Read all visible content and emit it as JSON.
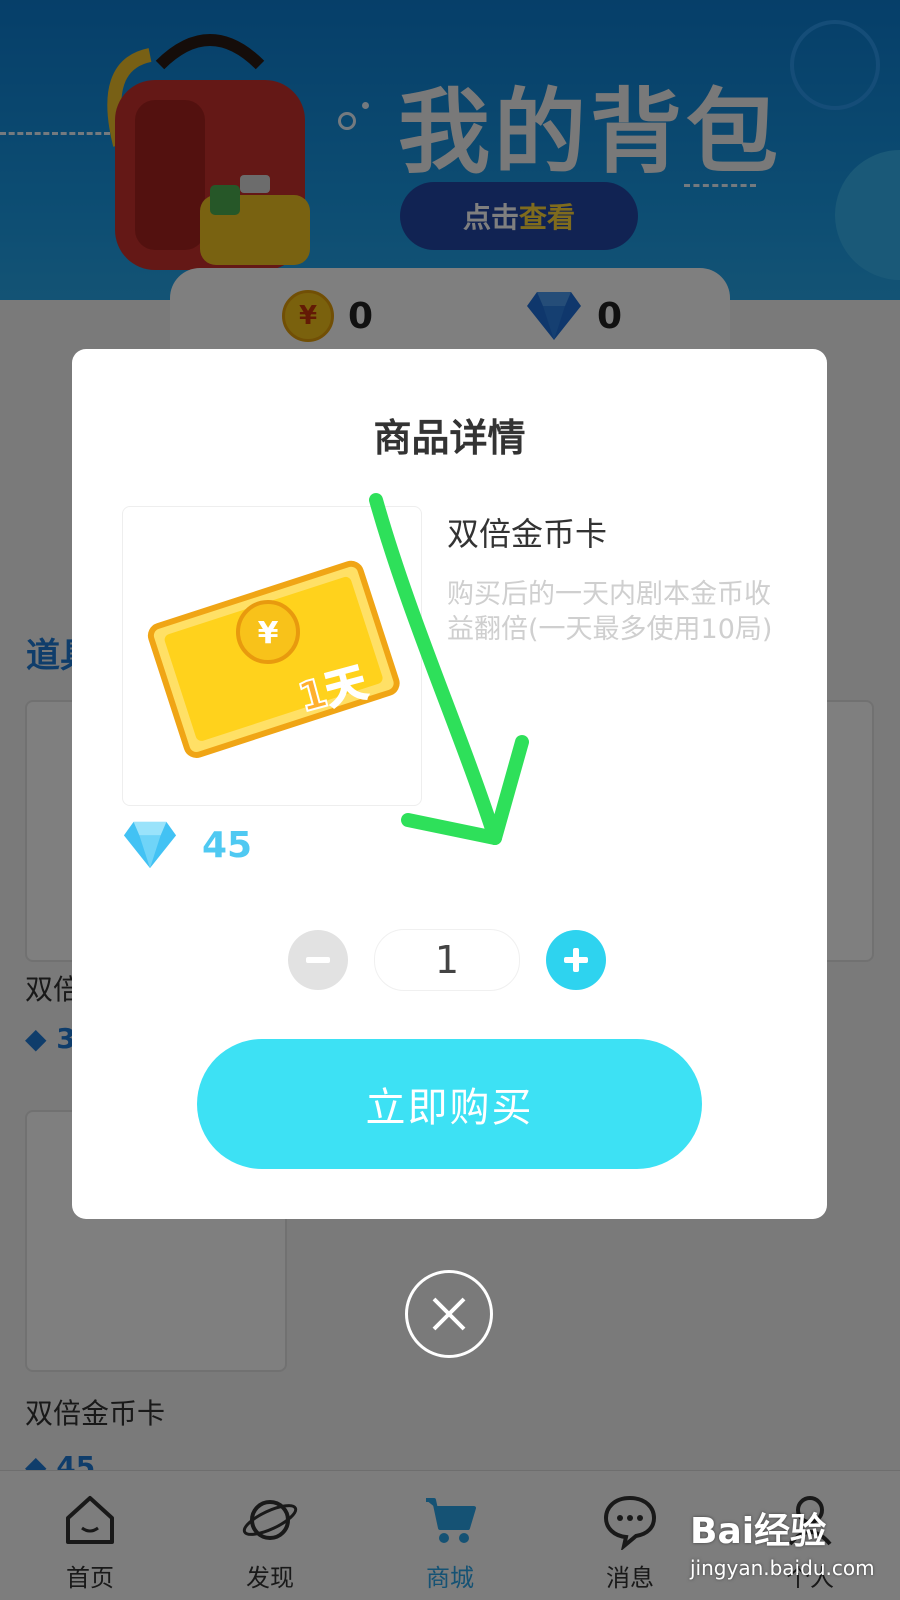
{
  "banner": {
    "title": "我的背包",
    "cta_prefix": "点击",
    "cta_highlight": "查看"
  },
  "balances": {
    "coin_symbol": "¥",
    "coins": "0",
    "gems": "0"
  },
  "background": {
    "section_title": "道具",
    "item1_name": "双倍",
    "item1_price": "3",
    "item2_name": "双倍金币卡",
    "item2_price": "45"
  },
  "tabs": [
    {
      "label": "首页",
      "icon": "house-icon"
    },
    {
      "label": "发现",
      "icon": "planet-icon"
    },
    {
      "label": "商城",
      "icon": "cart-icon",
      "active": true
    },
    {
      "label": "消息",
      "icon": "chat-icon"
    },
    {
      "label": "个人",
      "icon": "user-icon"
    }
  ],
  "modal": {
    "title": "商品详情",
    "product_name": "双倍金币卡",
    "product_desc": "购买后的一天内剧本金币收益翻倍(一天最多使用10局)",
    "card_coin_symbol": "¥",
    "card_badge": "1天",
    "price": "45",
    "quantity": "1",
    "buy_label": "立即购买"
  },
  "watermark": {
    "brand": "Bai经验",
    "url": "jingyan.baidu.com"
  },
  "colors": {
    "accent": "#3de1f4",
    "plus": "#2ed3ef",
    "annotation_arrow": "#2ee05a",
    "price": "#4fc9f2"
  }
}
